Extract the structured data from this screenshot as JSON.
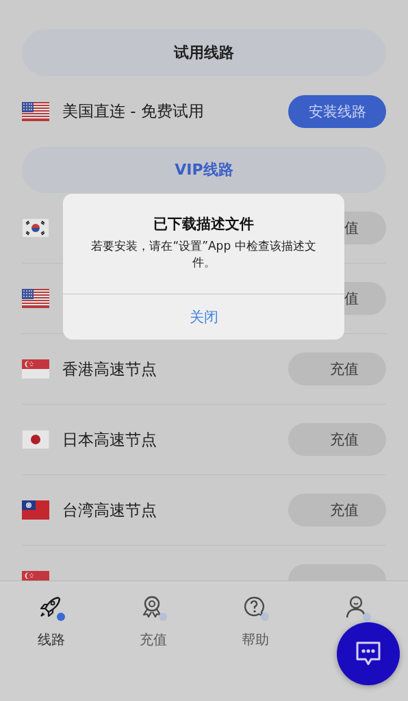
{
  "trial_header": "试用线路",
  "trial_line": {
    "kind": "us",
    "name": "美国直连 - 免费试用",
    "button": "安装线路"
  },
  "vip_header": "VIP线路",
  "vip_lines": [
    {
      "kind": "kr",
      "button": "值"
    },
    {
      "kind": "us",
      "button": "值"
    },
    {
      "kind": "sg",
      "name": "香港高速节点",
      "button": "充值"
    },
    {
      "kind": "jp",
      "name": "日本高速节点",
      "button": "充值"
    },
    {
      "kind": "tw",
      "name": "台湾高速节点",
      "button": "充值"
    },
    {
      "kind": "sg"
    }
  ],
  "alert": {
    "title": "已下载描述文件",
    "message": "若要安装，请在“设置”App 中检查该描述文件。",
    "button": "关闭"
  },
  "tab_bar": [
    {
      "label": "线路",
      "selected": true
    },
    {
      "label": "充值",
      "selected": false
    },
    {
      "label": "帮助",
      "selected": false
    },
    {
      "selected": false
    }
  ]
}
